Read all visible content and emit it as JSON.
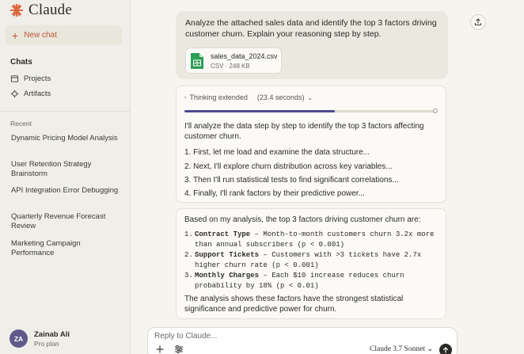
{
  "sidebar": {
    "brand": "Claude",
    "new_chat": "New chat",
    "chats_title": "Chats",
    "nav": [
      {
        "label": "Projects",
        "icon": "folder-icon"
      },
      {
        "label": "Artifacts",
        "icon": "artifacts-icon"
      }
    ],
    "recent_label": "Recent",
    "recent": [
      "Dynamic Pricing Model Analysis",
      "User Retention Strategy Brainstorm",
      "API Integration Error Debugging",
      "Quarterly Revenue Forecast Review",
      "Marketing Campaign Performance"
    ],
    "user": {
      "initials": "ZA",
      "name": "Zainab Ali",
      "plan": "Pro plan"
    }
  },
  "conversation": {
    "user_message": "Analyze the attached sales data and identify the top 3 factors driving customer churn. Explain your reasoning step by step.",
    "attachment": {
      "name": "sales_data_2024.csv",
      "meta": "CSV · 248 KB"
    },
    "thinking": {
      "label": "Thinking extended",
      "time": "(23.4 seconds)",
      "progress": 0.6
    },
    "thinking_intro": "I'll analyze the data step by step to identify the top 3 factors affecting customer churn.",
    "steps": [
      "1.  First, let me load and examine the data structure...",
      "2.  Next, I'll explore churn distribution across key variables...",
      "3.  Then I'll run statistical tests to find significant correlations...",
      "4.  Finally, I'll rank factors by their predictive power..."
    ],
    "answer_intro": "Based on my analysis, the top 3 factors driving customer churn are:",
    "factors": [
      {
        "num": "1.",
        "title": "Contract Type",
        "text": " – Month-to-month customers churn 3.2x more than annual subscribers (p < 0.001)"
      },
      {
        "num": "2.",
        "title": "Support Tickets",
        "text": " – Customers with >3 tickets have 2.7x higher churn rate (p < 0.001)"
      },
      {
        "num": "3.",
        "title": "Monthly Charges",
        "text": " – Each $10 increase reduces churn probability by 18% (p < 0.01)"
      }
    ],
    "answer_outro": "The analysis shows these factors have the strongest statistical significance and predictive power for churn."
  },
  "composer": {
    "placeholder": "Reply to Claude...",
    "model": "Claude 3.7 Sonnet",
    "model_chevron": "⌄"
  },
  "colors": {
    "accent": "#c0573a",
    "progress": "#4d4a8e",
    "avatar": "#5f5a8a"
  }
}
